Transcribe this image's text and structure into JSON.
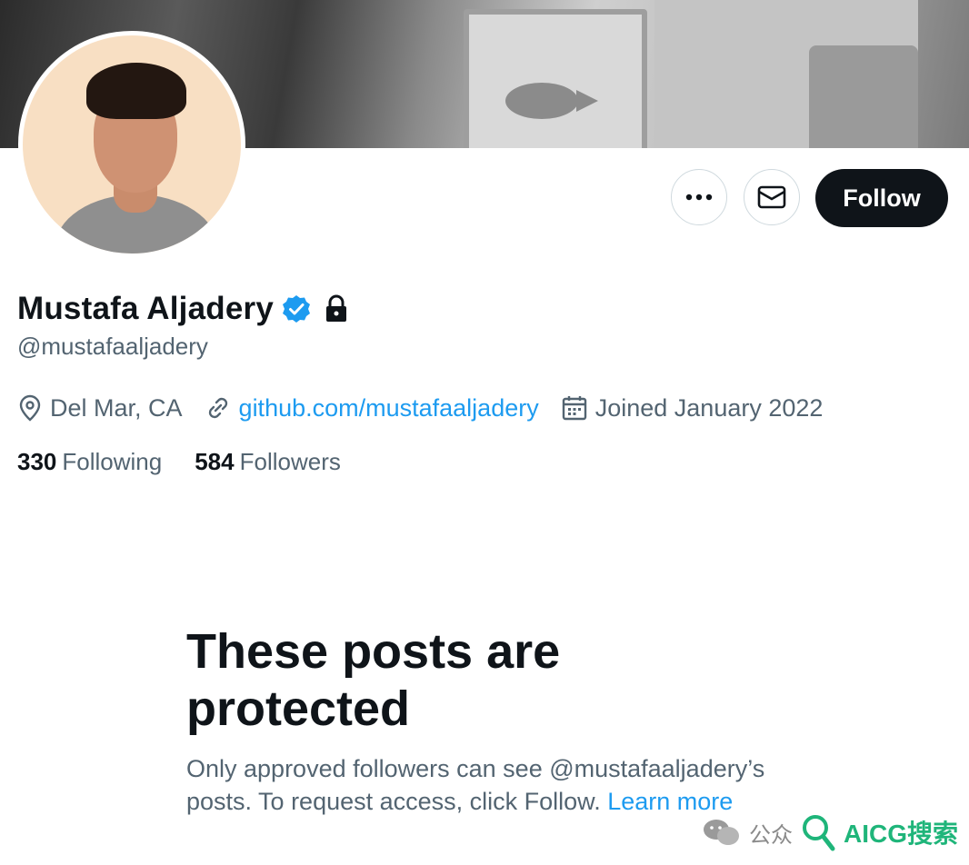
{
  "profile": {
    "display_name": "Mustafa Aljadery",
    "handle": "@mustafaaljadery",
    "verified": true,
    "protected": true,
    "location": "Del Mar, CA",
    "website": "github.com/mustafaaljadery",
    "joined": "Joined January 2022"
  },
  "stats": {
    "following_count": "330",
    "following_label": "Following",
    "followers_count": "584",
    "followers_label": "Followers"
  },
  "actions": {
    "more_icon": "more-horizontal-icon",
    "message_icon": "envelope-icon",
    "follow_label": "Follow"
  },
  "protected_notice": {
    "title": "These posts are protected",
    "body": "Only approved followers can see @mustafaaljadery’s posts. To request access, click Follow.",
    "learn_more": "Learn more"
  },
  "watermark": {
    "prefix": "公众",
    "brand": "AICG搜索"
  },
  "colors": {
    "accent": "#1d9bf0",
    "text_primary": "#0f1419",
    "text_secondary": "#536471",
    "follow_bg": "#0f1419"
  }
}
